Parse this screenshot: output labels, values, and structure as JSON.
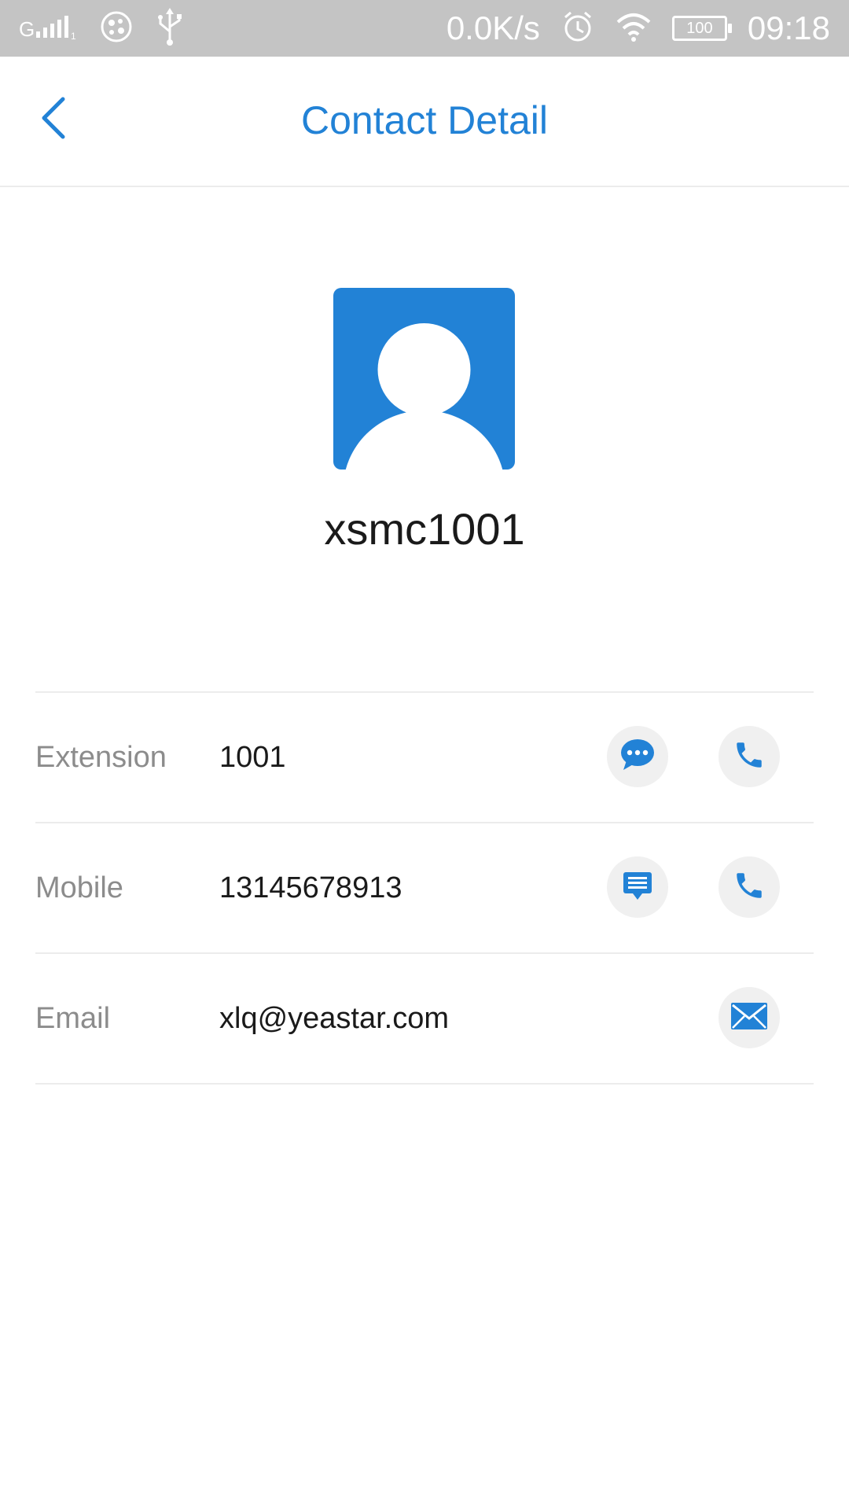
{
  "status_bar": {
    "network_speed": "0.0K/s",
    "battery": "100",
    "time": "09:18"
  },
  "header": {
    "title": "Contact Detail"
  },
  "contact": {
    "name": "xsmc1001"
  },
  "rows": [
    {
      "label": "Extension",
      "value": "1001"
    },
    {
      "label": "Mobile",
      "value": "13145678913"
    },
    {
      "label": "Email",
      "value": "xlq@yeastar.com"
    }
  ],
  "colors": {
    "accent": "#2282d6",
    "status_bar_bg": "#c4c4c4",
    "label_gray": "#8c8c8c",
    "divider": "#ececec",
    "button_bg": "#f0f0f0"
  }
}
